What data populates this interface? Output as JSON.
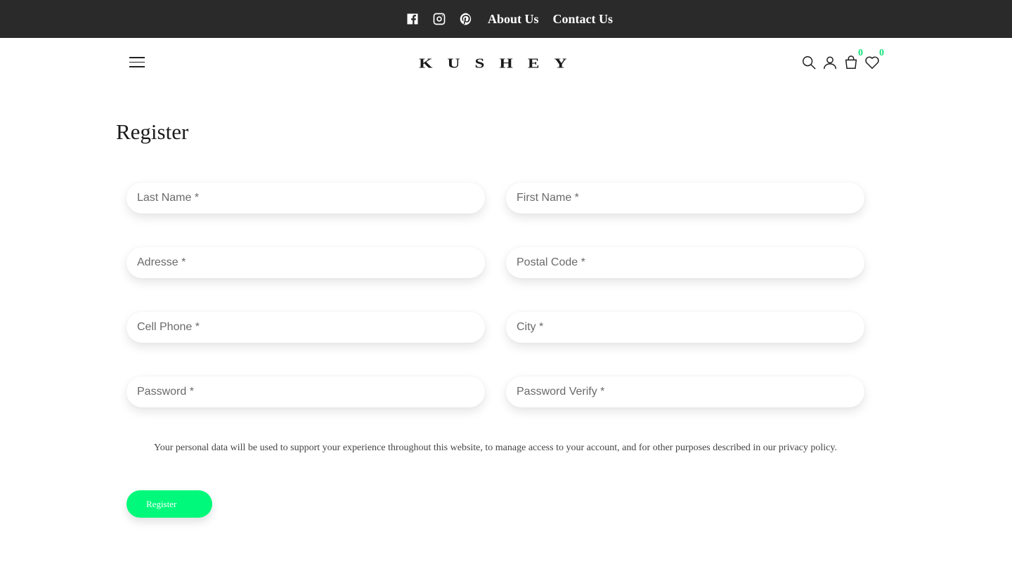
{
  "topbar": {
    "social": [
      {
        "icon": "facebook-icon"
      },
      {
        "icon": "instagram-icon"
      },
      {
        "icon": "pinterest-icon"
      }
    ],
    "links": [
      "About Us",
      "Contact Us"
    ]
  },
  "header": {
    "logo": "KUSHEY",
    "cart_count": "0",
    "wishlist_count": "0",
    "icons": [
      "search-icon",
      "user-icon",
      "cart-icon",
      "heart-icon"
    ]
  },
  "page": {
    "title": "Register"
  },
  "form": {
    "last_name": {
      "placeholder": "Last Name *",
      "value": ""
    },
    "first_name": {
      "placeholder": "First Name *",
      "value": ""
    },
    "address": {
      "placeholder": "Adresse *",
      "value": ""
    },
    "postal_code": {
      "placeholder": "Postal Code *",
      "value": ""
    },
    "cell_phone": {
      "placeholder": "Cell Phone *",
      "value": ""
    },
    "city": {
      "placeholder": "City *",
      "value": ""
    },
    "password": {
      "placeholder": "Password *",
      "value": ""
    },
    "password_verify": {
      "placeholder": "Password Verify *",
      "value": ""
    },
    "policy_text": "Your personal data will be used to support your experience throughout this website, to manage access to your account, and for other purposes described in our privacy policy.",
    "submit_label": "Register"
  },
  "colors": {
    "topbar_bg": "#2a2a2a",
    "accent": "#00f97a",
    "badge": "#10e37a"
  }
}
